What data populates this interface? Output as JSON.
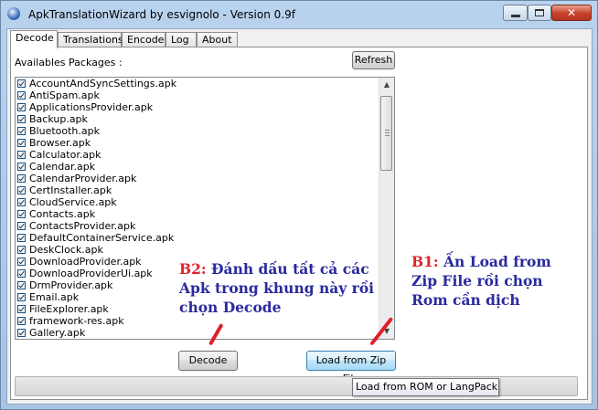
{
  "window": {
    "title": "ApkTranslationWizard by esvignolo - Version 0.9f",
    "close_glyph": "✕"
  },
  "tabs": [
    {
      "label": "Decode",
      "active": true
    },
    {
      "label": "Translations",
      "active": false
    },
    {
      "label": "Encode",
      "active": false
    },
    {
      "label": "Log",
      "active": false
    },
    {
      "label": "About",
      "active": false
    }
  ],
  "decode_panel": {
    "available_label": "Availables Packages :",
    "refresh_label": "Refresh",
    "packages": [
      "AccountAndSyncSettings.apk",
      "AntiSpam.apk",
      "ApplicationsProvider.apk",
      "Backup.apk",
      "Bluetooth.apk",
      "Browser.apk",
      "Calculator.apk",
      "Calendar.apk",
      "CalendarProvider.apk",
      "CertInstaller.apk",
      "CloudService.apk",
      "Contacts.apk",
      "ContactsProvider.apk",
      "DefaultContainerService.apk",
      "DeskClock.apk",
      "DownloadProvider.apk",
      "DownloadProviderUi.apk",
      "DrmProvider.apk",
      "Email.apk",
      "FileExplorer.apk",
      "framework-res.apk",
      "Gallery.apk"
    ],
    "decode_label": "Decode",
    "load_zip_label": "Load from Zip File"
  },
  "tooltip": {
    "text": "Load from ROM or LangPack"
  },
  "annotations": {
    "b2_number": "B2:",
    "b2_line1": " Đánh dấu tất cả các",
    "b2_line2": "Apk trong khung này rồi",
    "b2_line3": "chọn Decode",
    "b1_number": "B1:",
    "b1_line1": " Ấn Load from",
    "b1_line2": "Zip File rồi chọn",
    "b1_line3": "Rom cần dịch"
  },
  "colors": {
    "annotation_text": "#2a2a9e",
    "annotation_number": "#e0222a",
    "arrow": "#e01f28"
  }
}
